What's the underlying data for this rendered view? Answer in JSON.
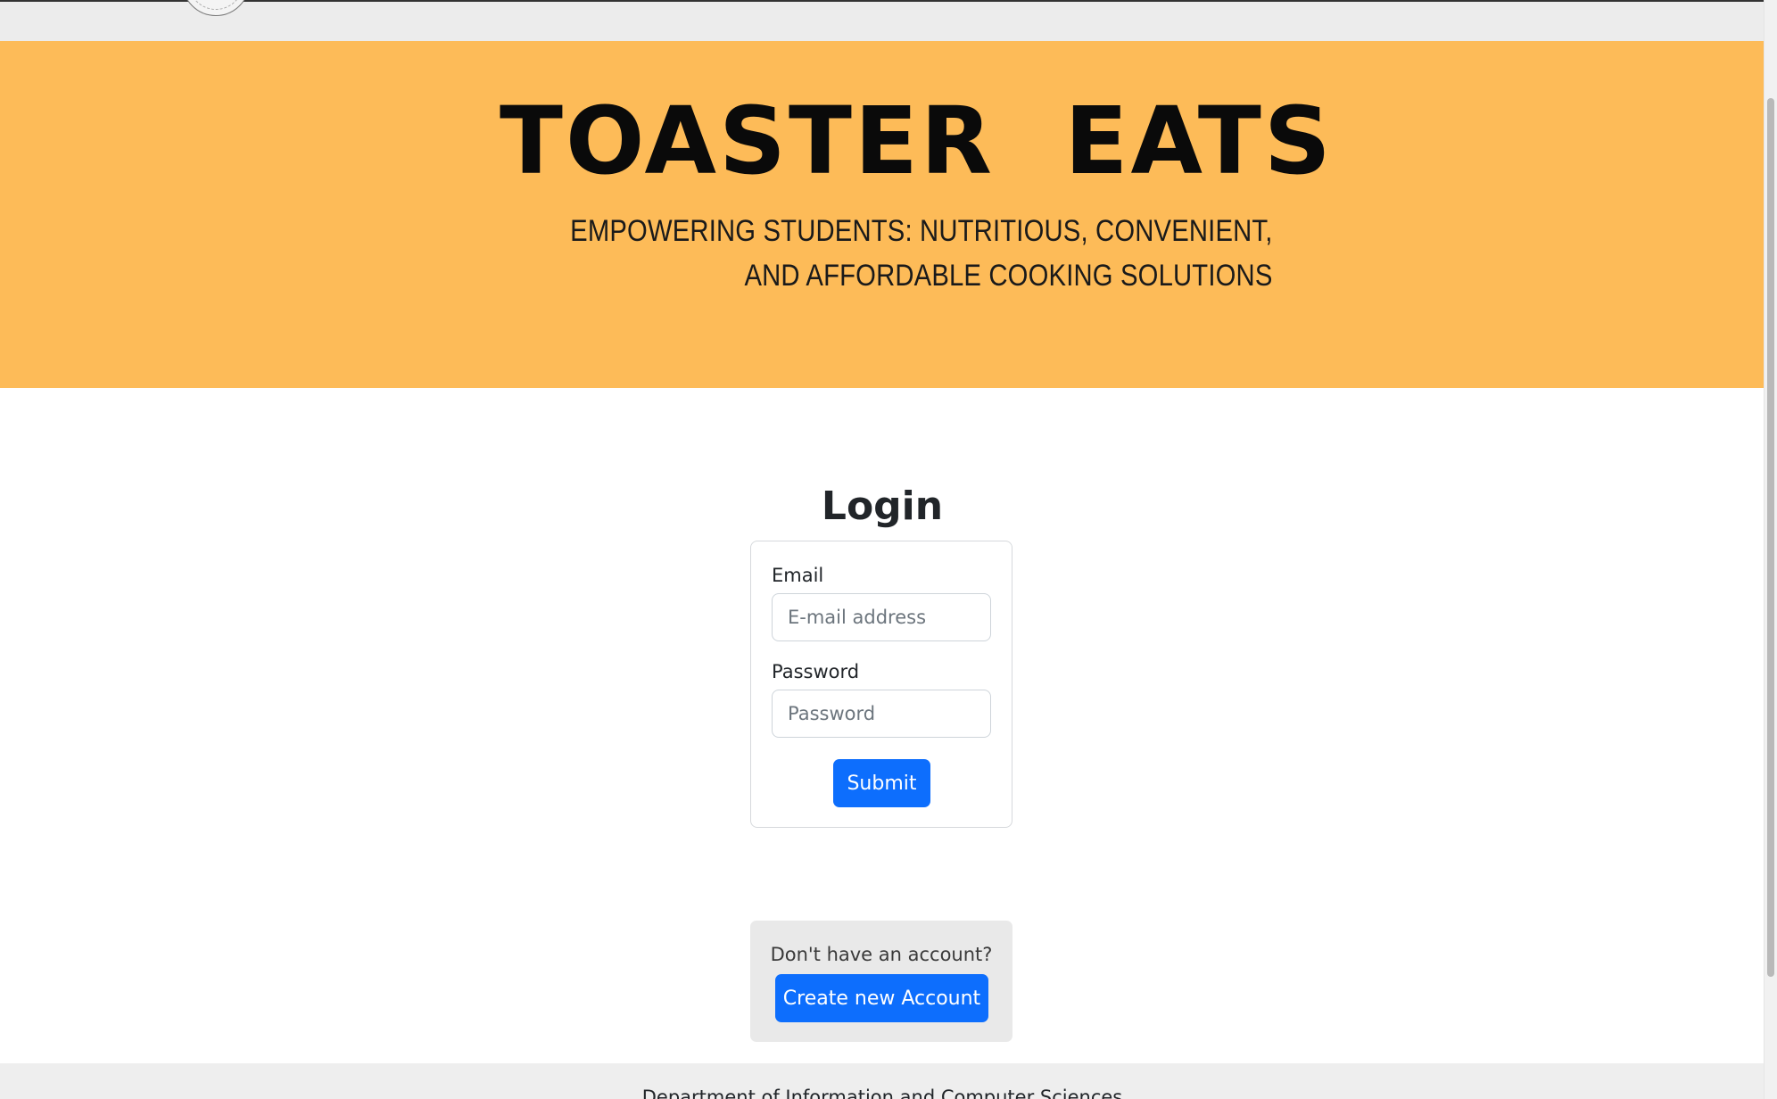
{
  "hero": {
    "title": "TOASTER  EATS",
    "subtitle_line1": "EMPOWERING STUDENTS: NUTRITIOUS, CONVENIENT,",
    "subtitle_line2": "AND AFFORDABLE COOKING SOLUTIONS",
    "background_color": "#fdbb58"
  },
  "login": {
    "title": "Login",
    "email_label": "Email",
    "email_placeholder": "E-mail address",
    "email_value": "",
    "password_label": "Password",
    "password_placeholder": "Password",
    "password_value": "",
    "submit_label": "Submit"
  },
  "signup": {
    "prompt": "Don't have an account?",
    "create_label": "Create new Account"
  },
  "footer": {
    "text": "Department of Information and Computer Sciences"
  },
  "colors": {
    "primary_button": "#0d6efd",
    "navbar": "#ececec"
  },
  "icons": {
    "navbar_logo": "seal-logo-icon"
  }
}
